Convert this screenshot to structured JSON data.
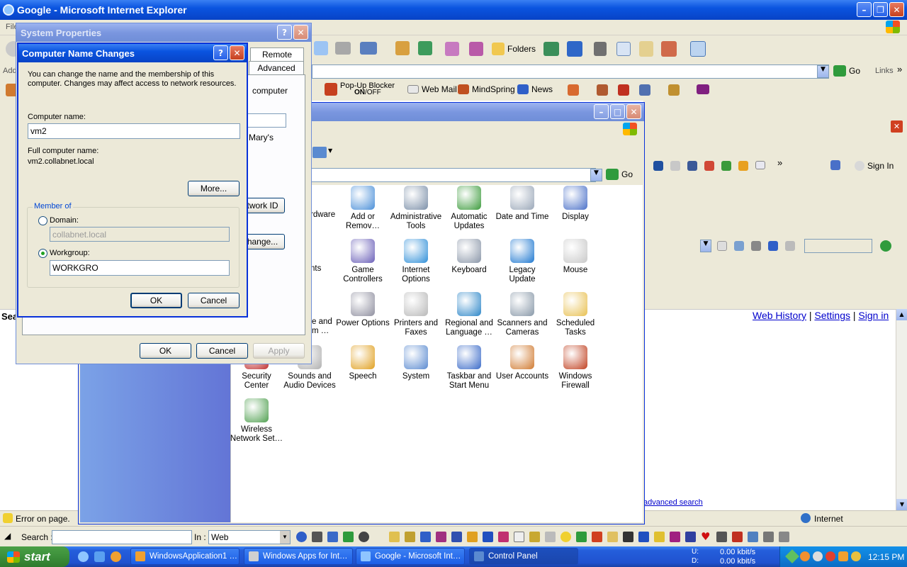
{
  "ie": {
    "title": "Google - Microsoft Internet Explorer",
    "menu_first": "File",
    "address_label": "Address",
    "go_label": "Go",
    "links_label": "Links",
    "toolbar": {
      "folders": "Folders",
      "popup_blocker": "Pop-Up Blocker",
      "popup_state_on": "ON",
      "popup_state_off": "OFF",
      "web_mail": "Web Mail",
      "mindspring": "MindSpring",
      "news": "News",
      "sign_in": "Sign In",
      "more": "»"
    },
    "page": {
      "web_history": "Web History",
      "settings": "Settings",
      "sign_in": "Sign in",
      "advanced_search": "advanced search",
      "sep": "|"
    },
    "status": {
      "error": "Error on page.",
      "zone": "Internet"
    }
  },
  "control_panel": {
    "go_label": "Go",
    "items": [
      {
        "label": "Add or Remov…",
        "icon": "add-remove-icon",
        "color": "#4a8fd8"
      },
      {
        "label": "Administrative Tools",
        "icon": "admin-tools-icon",
        "color": "#7b8fa8"
      },
      {
        "label": "Automatic Updates",
        "icon": "windows-flag-icon",
        "color": "#3c9b3c"
      },
      {
        "label": "Date and Time",
        "icon": "clock-icon",
        "color": "#9aa7b8"
      },
      {
        "label": "Display",
        "icon": "display-icon",
        "color": "#4a70c8"
      },
      {
        "label": "Game Controllers",
        "icon": "gamepad-icon",
        "color": "#6a5fb8"
      },
      {
        "label": "Internet Options",
        "icon": "globe-icon",
        "color": "#2f8fd8"
      },
      {
        "label": "Keyboard",
        "icon": "keyboard-icon",
        "color": "#8a96a8"
      },
      {
        "label": "Legacy Update",
        "icon": "update-arrow-icon",
        "color": "#1f78d0"
      },
      {
        "label": "Mouse",
        "icon": "mouse-icon",
        "color": "#c8c8c8"
      },
      {
        "label": "Power Options",
        "icon": "power-icon",
        "color": "#8f8f9f"
      },
      {
        "label": "Printers and Faxes",
        "icon": "printer-icon",
        "color": "#b8b8b8"
      },
      {
        "label": "Regional and Language …",
        "icon": "globe-stand-icon",
        "color": "#2c86c8"
      },
      {
        "label": "Scanners and Cameras",
        "icon": "scanner-icon",
        "color": "#8898a8"
      },
      {
        "label": "Scheduled Tasks",
        "icon": "folder-clock-icon",
        "color": "#e8c050"
      },
      {
        "label": "Security Center",
        "icon": "shield-icon",
        "color": "#c03030"
      },
      {
        "label": "Sounds and Audio Devices",
        "icon": "speaker-icon",
        "color": "#b0b0b0"
      },
      {
        "label": "Speech",
        "icon": "speech-icon",
        "color": "#e0a020"
      },
      {
        "label": "System",
        "icon": "system-icon",
        "color": "#5a8ad0"
      },
      {
        "label": "Taskbar and Start Menu",
        "icon": "taskbar-icon",
        "color": "#3a6ac8"
      },
      {
        "label": "User Accounts",
        "icon": "users-icon",
        "color": "#d07a30"
      },
      {
        "label": "Windows Firewall",
        "icon": "firewall-icon",
        "color": "#c04020"
      },
      {
        "label": "Wireless Network Set…",
        "icon": "wireless-icon",
        "color": "#50a050"
      }
    ],
    "partial": {
      "hardware": "rdware",
      "ents": "nts",
      "and_line1": "e and",
      "and_line2": "m …"
    }
  },
  "system_properties": {
    "title": "System Properties",
    "tabs": {
      "remote": "Remote",
      "advanced": "Advanced"
    },
    "partial_computer": "computer",
    "partial_marys": "Mary's",
    "network_id_btn": "twork ID",
    "change_btn": "hange...",
    "ok": "OK",
    "cancel": "Cancel",
    "apply": "Apply"
  },
  "computer_name_changes": {
    "title": "Computer Name Changes",
    "description": "You can change the name and the membership of this computer. Changes may affect access to network resources.",
    "computer_name_label": "Computer name:",
    "computer_name_value": "vm2",
    "full_name_label": "Full computer name:",
    "full_name_value": "vm2.collabnet.local",
    "more_btn": "More...",
    "member_of": "Member of",
    "domain_label": "Domain:",
    "domain_value": "collabnet.local",
    "workgroup_label": "Workgroup:",
    "workgroup_value": "WORKGRO",
    "ok": "OK",
    "cancel": "Cancel"
  },
  "search_bar": {
    "search_label": "Search :",
    "in_label": "In :",
    "in_value": "Web"
  },
  "taskbar": {
    "start": "start",
    "tasks": [
      {
        "label": "WindowsApplication1 …",
        "active": false
      },
      {
        "label": "Windows Apps for Int…",
        "active": false
      },
      {
        "label": "Google - Microsoft Int…",
        "active": false
      },
      {
        "label": "Control Panel",
        "active": true
      }
    ],
    "net_u_label": "U:",
    "net_d_label": "D:",
    "net_u": "0.00 kbit/s",
    "net_d": "0.00 kbit/s",
    "clock": "12:15 PM"
  }
}
